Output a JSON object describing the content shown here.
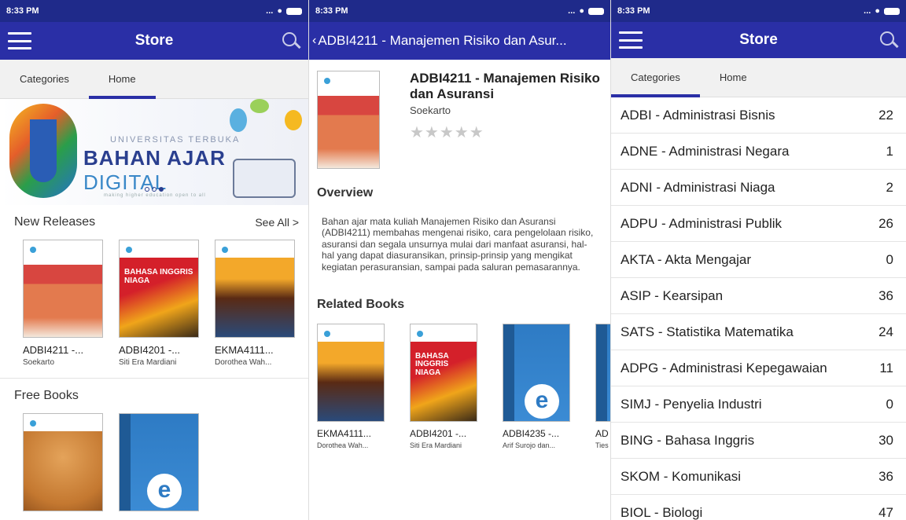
{
  "status": {
    "time": "8:33 PM",
    "signal": "..."
  },
  "store": {
    "title": "Store",
    "tabs": [
      "Categories",
      "Home"
    ],
    "banner": {
      "subtitle": "UNIVERSITAS TERBUKA",
      "main_bold": "BAHAN AJAR",
      "main_light": "DIGITAL",
      "tagline": "making higher education open to all",
      "logo_text": "BAHAN AJAR DIGITAL"
    },
    "new_releases": {
      "label": "New Releases",
      "see_all": "See All >",
      "books": [
        {
          "title": "ADBI4211 -...",
          "author": "Soekarto"
        },
        {
          "title": "ADBI4201 -...",
          "author": "Siti Era Mardiani",
          "cover_text": "BAHASA INGGRIS NIAGA"
        },
        {
          "title": "EKMA4111...",
          "author": "Dorothea Wah..."
        }
      ]
    },
    "free_books": {
      "label": "Free Books"
    }
  },
  "detail": {
    "appbar_title": "ADBI4211 - Manajemen Risiko dan Asur...",
    "back_icon": "‹",
    "title": "ADBI4211 - Manajemen Risiko dan Asuransi",
    "author": "Soekarto",
    "stars": "★★★★★",
    "overview_label": "Overview",
    "overview_text": "Bahan ajar mata kuliah Manajemen Risiko dan Asuransi (ADBI4211) membahas mengenai risiko, cara pengelolaan risiko, asuransi dan segala unsurnya mulai dari manfaat asuransi, hal-hal yang dapat diasuransikan, prinsip-prinsip yang mengikat kegiatan perasuransian, sampai pada saluran pemasarannya.",
    "related_label": "Related Books",
    "related": [
      {
        "title": "EKMA4111...",
        "author": "Dorothea Wah..."
      },
      {
        "title": "ADBI4201 -...",
        "author": "Siti Era Mardiani",
        "cover_text": "BAHASA INGGRIS NIAGA"
      },
      {
        "title": "ADBI4235 -...",
        "author": "Arif Surojo dan..."
      },
      {
        "title": "AD",
        "author": "Ties"
      }
    ]
  },
  "categories": {
    "title": "Store",
    "tabs": [
      "Categories",
      "Home"
    ],
    "items": [
      {
        "name": "ADBI - Administrasi Bisnis",
        "count": "22"
      },
      {
        "name": "ADNE - Administrasi Negara",
        "count": "1"
      },
      {
        "name": "ADNI - Administrasi Niaga",
        "count": "2"
      },
      {
        "name": "ADPU - Administrasi Publik",
        "count": "26"
      },
      {
        "name": "AKTA - Akta Mengajar",
        "count": "0"
      },
      {
        "name": "ASIP - Kearsipan",
        "count": "36"
      },
      {
        "name": "SATS - Statistika Matematika",
        "count": "24"
      },
      {
        "name": "ADPG - Administrasi Kepegawaian",
        "count": "11"
      },
      {
        "name": "SIMJ - Penyelia Industri",
        "count": "0"
      },
      {
        "name": "BING - Bahasa Inggris",
        "count": "30"
      },
      {
        "name": "SKOM - Komunikasi",
        "count": "36"
      },
      {
        "name": "BIOL - Biologi",
        "count": "47"
      }
    ]
  },
  "colors": {
    "appbar": "#2a2fa6",
    "statusbar": "#1f2a8a",
    "tab_indicator": "#2a2fa6"
  },
  "icons": {
    "menu": "hamburger-icon",
    "search": "search-icon",
    "back": "chevron-left-icon",
    "star": "star-icon"
  }
}
